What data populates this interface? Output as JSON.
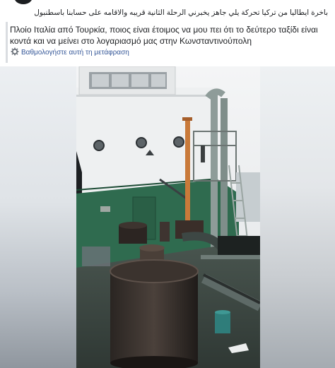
{
  "post": {
    "original_text": "باخرة ايطاليا من تركيا تحركة يلي جاهز يخبرني الرحلة الثانية قريبه والاقامه على حسابنا باسطنبول",
    "translation": "Πλοίο Ιταλία από Τουρκία, ποιος είναι έτοιμος να μου πει ότι το δεύτερο ταξίδι είναι κοντά και να μείνει στο λογαριασμό μας στην Κωνσταντινούπολη",
    "rate_translation": "Βαθμολογήστε αυτή τη μετάφραση"
  },
  "icons": {
    "avatar": "avatar",
    "rate": "gear-icon"
  },
  "colors": {
    "link": "#365899",
    "hull_green": "#2f6b4f",
    "deck": "#3f4a45"
  }
}
